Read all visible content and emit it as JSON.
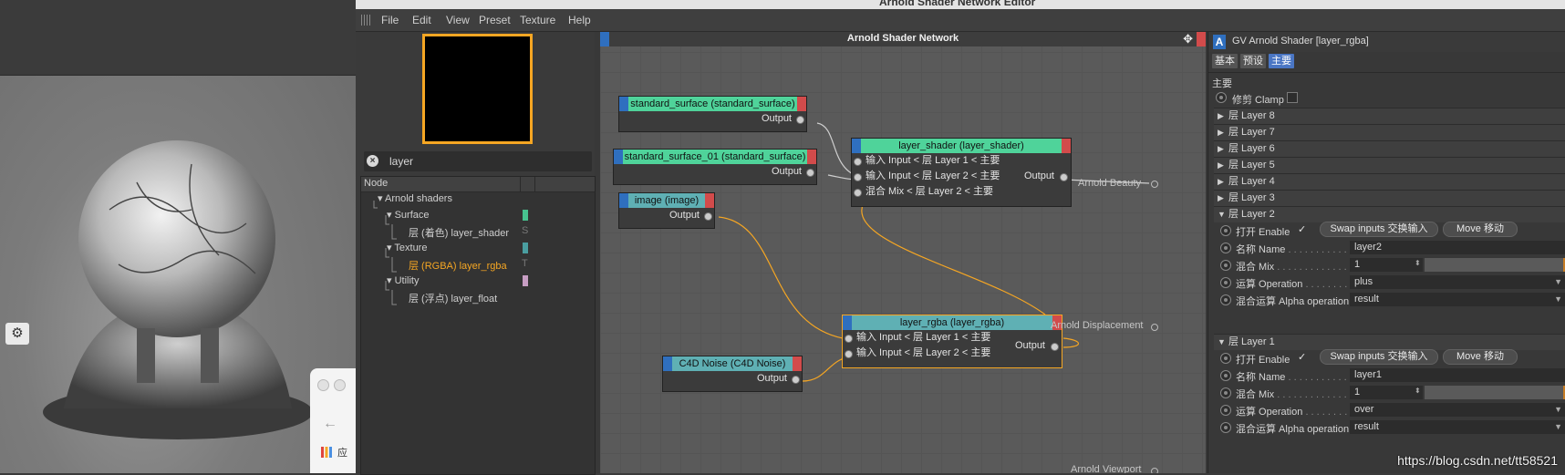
{
  "window": {
    "title": "Arnold Shader Network Editor"
  },
  "menu": [
    "File",
    "Edit",
    "View",
    "Preset",
    "Texture",
    "Help"
  ],
  "search": {
    "value": "layer"
  },
  "tree": {
    "header": "Node",
    "items": [
      {
        "label": "Arnold shaders",
        "letter": "",
        "swatch": ""
      },
      {
        "label": "Surface",
        "letter": "",
        "swatch": "#47c28f"
      },
      {
        "label": "层 (着色) layer_shader",
        "letter": "S",
        "swatch": ""
      },
      {
        "label": "Texture",
        "letter": "",
        "swatch": "#4a9ea0"
      },
      {
        "label": "层 (RGBA) layer_rgba",
        "letter": "T",
        "swatch": "",
        "selected": true
      },
      {
        "label": "Utility",
        "letter": "",
        "swatch": "#c79ec3"
      },
      {
        "label": "层 (浮点) layer_float",
        "letter": "",
        "swatch": ""
      }
    ]
  },
  "graph": {
    "title": "Arnold Shader Network",
    "nodes": {
      "ss": {
        "title": "standard_surface (standard_surface)",
        "out": "Output",
        "color": "#4fd39a"
      },
      "ss01": {
        "title": "standard_surface_01 (standard_surface)",
        "out": "Output",
        "color": "#4fd39a"
      },
      "img": {
        "title": "image (image)",
        "out": "Output",
        "color": "#5fb0b4"
      },
      "ls": {
        "title": "layer_shader (layer_shader)",
        "out": "Output",
        "color": "#4fd39a",
        "inputs": [
          "输入 Input < 层 Layer 1 < 主要",
          "输入 Input < 层 Layer 2 < 主要",
          "混合 Mix < 层 Layer 2 < 主要"
        ]
      },
      "lr": {
        "title": "layer_rgba (layer_rgba)",
        "out": "Output",
        "color": "#5fb0b4",
        "inputs": [
          "输入 Input < 层 Layer 1 < 主要",
          "输入 Input < 层 Layer 2 < 主要"
        ]
      },
      "noise": {
        "title": "C4D Noise (C4D Noise)",
        "out": "Output",
        "color": "#5fb0b4"
      }
    },
    "outputs": {
      "beauty": "Arnold Beauty",
      "displacement": "Arnold Displacement",
      "viewport": "Arnold Viewport"
    }
  },
  "attributes": {
    "title": "GV Arnold Shader [layer_rgba]",
    "tabs": [
      "基本",
      "预设",
      "主要"
    ],
    "section": "主要",
    "clamp": "修剪 Clamp",
    "collapsed_layers": [
      "层 Layer 8",
      "层 Layer 7",
      "层 Layer 6",
      "层 Layer 5",
      "层 Layer 4",
      "层 Layer 3"
    ],
    "layers": [
      {
        "header": "层 Layer 2",
        "enable": "打开 Enable",
        "swap": "Swap inputs 交换输入",
        "move": "Move 移动",
        "name_label": "名称 Name",
        "name_value": "layer2",
        "mix_label": "混合 Mix",
        "mix_value": "1",
        "op_label": "运算 Operation",
        "op_value": "plus",
        "alpha_label": "混合运算 Alpha operation",
        "alpha_value": "result"
      },
      {
        "header": "层 Layer 1",
        "enable": "打开 Enable",
        "swap": "Swap inputs 交换输入",
        "move": "Move 移动",
        "name_label": "名称 Name",
        "name_value": "layer1",
        "mix_label": "混合 Mix",
        "mix_value": "1",
        "op_label": "运算 Operation",
        "op_value": "over",
        "alpha_label": "混合运算 Alpha operation",
        "alpha_value": "result"
      }
    ]
  },
  "browser": {
    "apps_label": "应"
  },
  "watermark": "https://blog.csdn.net/tt58521",
  "colors": {
    "accent": "#f5a623",
    "surface": "#47c28f",
    "texture": "#4a9ea0",
    "utility": "#c79ec3"
  }
}
